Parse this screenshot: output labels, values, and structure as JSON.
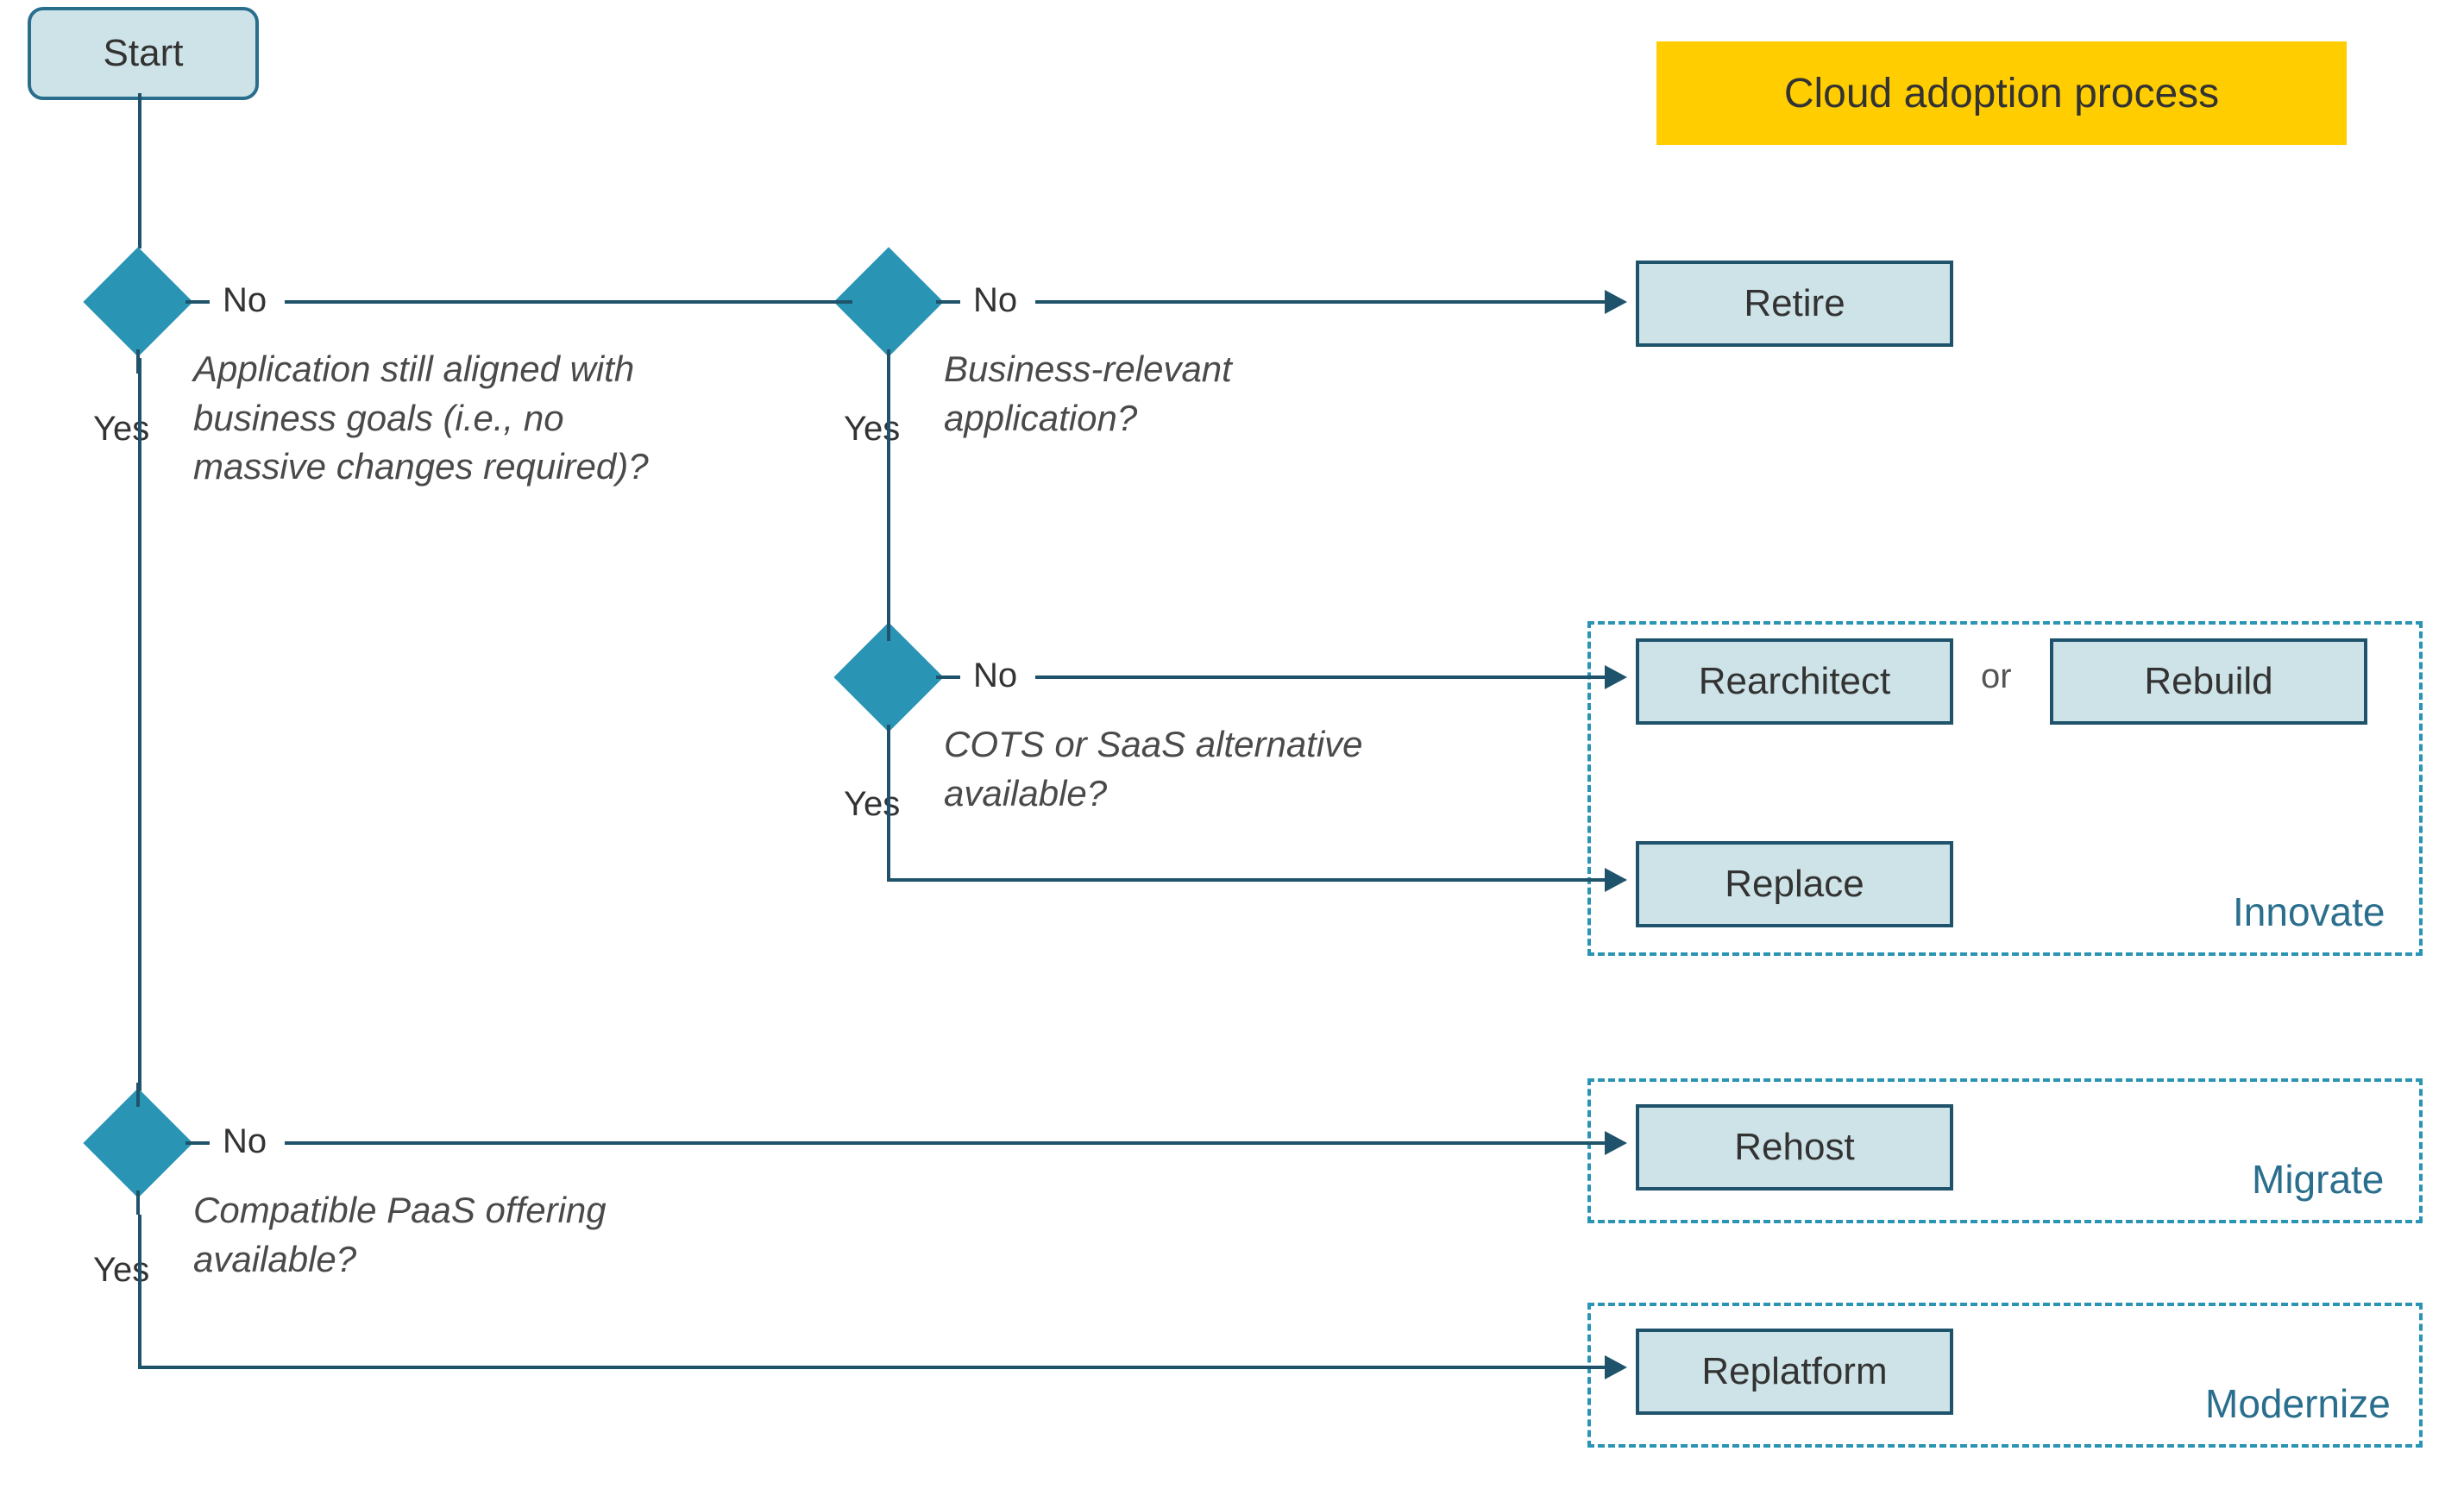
{
  "title": "Cloud adoption process",
  "start_label": "Start",
  "labels": {
    "yes": "Yes",
    "no": "No",
    "or": "or"
  },
  "decisions": {
    "d1": {
      "question": "Application still aligned with business goals (i.e., no massive changes required)?"
    },
    "d2": {
      "question": "Business-relevant application?"
    },
    "d3": {
      "question": "COTS or SaaS alternative available?"
    },
    "d4": {
      "question": "Compatible PaaS offering available?"
    }
  },
  "outcomes": {
    "retire": "Retire",
    "rearchitect": "Rearchitect",
    "rebuild": "Rebuild",
    "replace": "Replace",
    "rehost": "Rehost",
    "replatform": "Replatform"
  },
  "groups": {
    "innovate": "Innovate",
    "migrate": "Migrate",
    "modernize": "Modernize"
  },
  "chart_data": {
    "type": "flowchart",
    "title": "Cloud adoption process",
    "nodes": [
      {
        "id": "start",
        "type": "start",
        "label": "Start"
      },
      {
        "id": "d1",
        "type": "decision",
        "label": "Application still aligned with business goals (i.e., no massive changes required)?"
      },
      {
        "id": "d2",
        "type": "decision",
        "label": "Business-relevant application?"
      },
      {
        "id": "d3",
        "type": "decision",
        "label": "COTS or SaaS alternative available?"
      },
      {
        "id": "d4",
        "type": "decision",
        "label": "Compatible PaaS offering available?"
      },
      {
        "id": "retire",
        "type": "terminal",
        "label": "Retire"
      },
      {
        "id": "rearchitect",
        "type": "terminal",
        "label": "Rearchitect",
        "group": "innovate"
      },
      {
        "id": "rebuild",
        "type": "terminal",
        "label": "Rebuild",
        "group": "innovate"
      },
      {
        "id": "replace",
        "type": "terminal",
        "label": "Replace",
        "group": "innovate"
      },
      {
        "id": "rehost",
        "type": "terminal",
        "label": "Rehost",
        "group": "migrate"
      },
      {
        "id": "replatform",
        "type": "terminal",
        "label": "Replatform",
        "group": "modernize"
      }
    ],
    "edges": [
      {
        "from": "start",
        "to": "d1"
      },
      {
        "from": "d1",
        "to": "d2",
        "label": "No"
      },
      {
        "from": "d1",
        "to": "d4",
        "label": "Yes"
      },
      {
        "from": "d2",
        "to": "retire",
        "label": "No"
      },
      {
        "from": "d2",
        "to": "d3",
        "label": "Yes"
      },
      {
        "from": "d3",
        "to": "rearchitect",
        "label": "No",
        "note": "Rearchitect or Rebuild"
      },
      {
        "from": "d3",
        "to": "rebuild",
        "label": "No"
      },
      {
        "from": "d3",
        "to": "replace",
        "label": "Yes"
      },
      {
        "from": "d4",
        "to": "rehost",
        "label": "No"
      },
      {
        "from": "d4",
        "to": "replatform",
        "label": "Yes"
      }
    ],
    "groups": [
      {
        "id": "innovate",
        "label": "Innovate",
        "members": [
          "rearchitect",
          "rebuild",
          "replace"
        ]
      },
      {
        "id": "migrate",
        "label": "Migrate",
        "members": [
          "rehost"
        ]
      },
      {
        "id": "modernize",
        "label": "Modernize",
        "members": [
          "replatform"
        ]
      }
    ]
  }
}
